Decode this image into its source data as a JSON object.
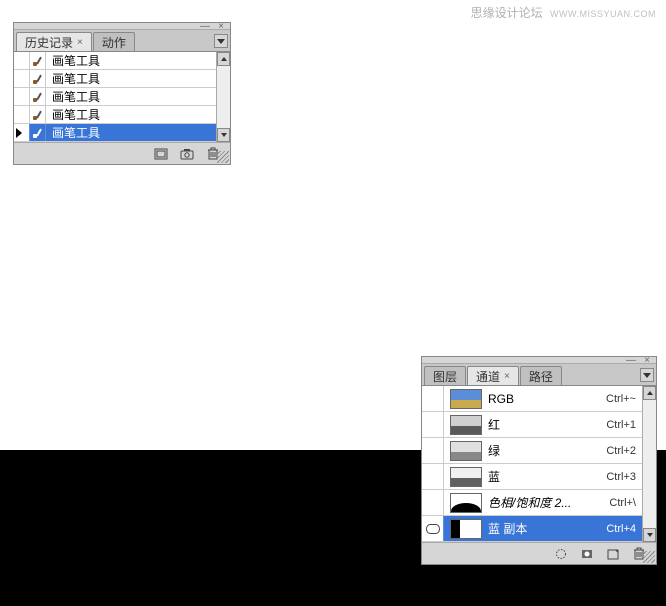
{
  "watermark": {
    "text": "思缘设计论坛",
    "url": "WWW.MISSYUAN.COM"
  },
  "history_panel": {
    "tabs": [
      {
        "label": "历史记录",
        "active": true,
        "closable": true
      },
      {
        "label": "动作",
        "active": false,
        "closable": false
      }
    ],
    "rows": [
      {
        "label": "画笔工具",
        "selected": false
      },
      {
        "label": "画笔工具",
        "selected": false
      },
      {
        "label": "画笔工具",
        "selected": false
      },
      {
        "label": "画笔工具",
        "selected": false
      },
      {
        "label": "画笔工具",
        "selected": true
      }
    ],
    "footer_icons": [
      "new-doc-from-state-icon",
      "snapshot-icon",
      "trash-icon"
    ]
  },
  "channels_panel": {
    "tabs": [
      {
        "label": "图层",
        "active": false,
        "closable": false
      },
      {
        "label": "通道",
        "active": true,
        "closable": true
      },
      {
        "label": "路径",
        "active": false,
        "closable": false
      }
    ],
    "rows": [
      {
        "label": "RGB",
        "shortcut": "Ctrl+~",
        "thumb": "rgb",
        "visible": false,
        "selected": false,
        "italic": false
      },
      {
        "label": "红",
        "shortcut": "Ctrl+1",
        "thumb": "red",
        "visible": false,
        "selected": false,
        "italic": false
      },
      {
        "label": "绿",
        "shortcut": "Ctrl+2",
        "thumb": "green",
        "visible": false,
        "selected": false,
        "italic": false
      },
      {
        "label": "蓝",
        "shortcut": "Ctrl+3",
        "thumb": "blue",
        "visible": false,
        "selected": false,
        "italic": false
      },
      {
        "label": "色相/饱和度 2...",
        "shortcut": "Ctrl+\\",
        "thumb": "mask",
        "visible": false,
        "selected": false,
        "italic": true
      },
      {
        "label": "蓝 副本",
        "shortcut": "Ctrl+4",
        "thumb": "bluecopy",
        "visible": true,
        "selected": true,
        "italic": false
      }
    ],
    "footer_icons": [
      "load-selection-icon",
      "save-selection-icon",
      "new-channel-icon",
      "trash-icon"
    ]
  }
}
